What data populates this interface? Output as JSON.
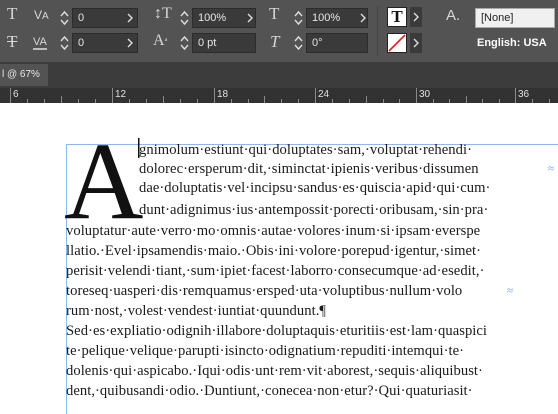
{
  "control": {
    "row1": {
      "tracking_value": "0",
      "font_size_value": "100%",
      "scale_value": "100%",
      "char_style": "[None]"
    },
    "row2": {
      "kerning_value": "0",
      "baseline_value": "0 pt",
      "skew_value": "0°",
      "language": "English: USA"
    }
  },
  "document_tab": {
    "label": "l @ 67%"
  },
  "ruler": {
    "labels": [
      "6",
      "12",
      "18",
      "24",
      "30",
      "36"
    ]
  },
  "text": {
    "dropcap": "A",
    "lines": [
      "gnimolum·estiunt·qui·doluptates·sam,·voluptat·rehendi·",
      "dolorec·ersperum·dit,·siminctat·ipienis·veribus·dissumen",
      "dae·doluptatis·vel·incipsu·sandus·es·quiscia·apid·qui·cum·",
      "dunt·adignimus·ius·antempossit·porecti·oribusam,·sin·pra·",
      "voluptatur·aute·verro·mo·omnis·autae·volores·inum·si·ipsam·everspe",
      "llatio.·Evel·ipsamendis·maio.·Obis·ini·volore·porepud·igentur,·simet·",
      "perisit·velendi·tiant,·sum·ipiet·facest·laborro·consecumque·ad·esedit,·",
      "toreseq·uasperi·dis·remquamus·ersped·uta·voluptibus·nullum·volo",
      "rum·nost,·volest·vendest·iuntiat·quundunt.¶",
      "Sed·es·expliatio·odignih·illabore·doluptaquis·eturitiis·est·lam·quaspici",
      "te·pelique·velique·parupti·isincto·odignatium·repuditi·intemqui·te·",
      "dolenis·qui·aspicabo.·Iqui·odis·unt·rem·vit·aborest,·sequis·aliquibust·",
      "dent,·quibusandi·odio.·Duntiunt,·conecea·non·etur?·Qui·quaturiasit·"
    ]
  }
}
